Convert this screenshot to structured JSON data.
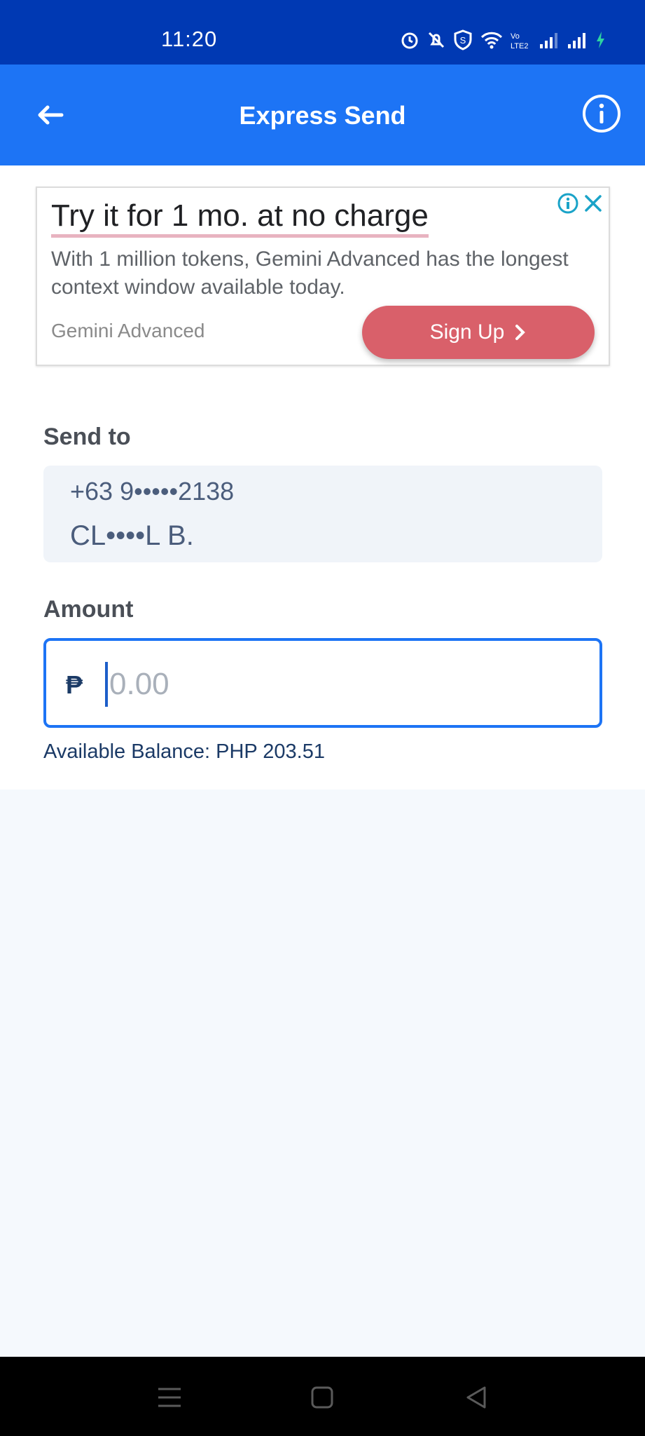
{
  "status_bar": {
    "time": "11:20"
  },
  "app_bar": {
    "title": "Express Send",
    "back_icon": "arrow-left-icon",
    "info_icon": "info-icon"
  },
  "ad": {
    "headline": "Try it for 1 mo. at no charge",
    "description": "With 1 million tokens, Gemini Advanced has the longest context window available today.",
    "advertiser": "Gemini Advanced",
    "cta_label": "Sign Up",
    "cta_color": "#d9606a"
  },
  "send_to": {
    "label": "Send to",
    "phone": "+63 9•••••2138",
    "name": "CL••••L B."
  },
  "amount": {
    "label": "Amount",
    "currency_symbol": "₱",
    "placeholder": "0.00",
    "value": ""
  },
  "balance": {
    "text": "Available Balance: PHP 203.51"
  },
  "colors": {
    "status_bar": "#0039b3",
    "app_bar": "#1d74f5",
    "accent": "#1d74f5",
    "text_dark": "#1b3a66"
  }
}
